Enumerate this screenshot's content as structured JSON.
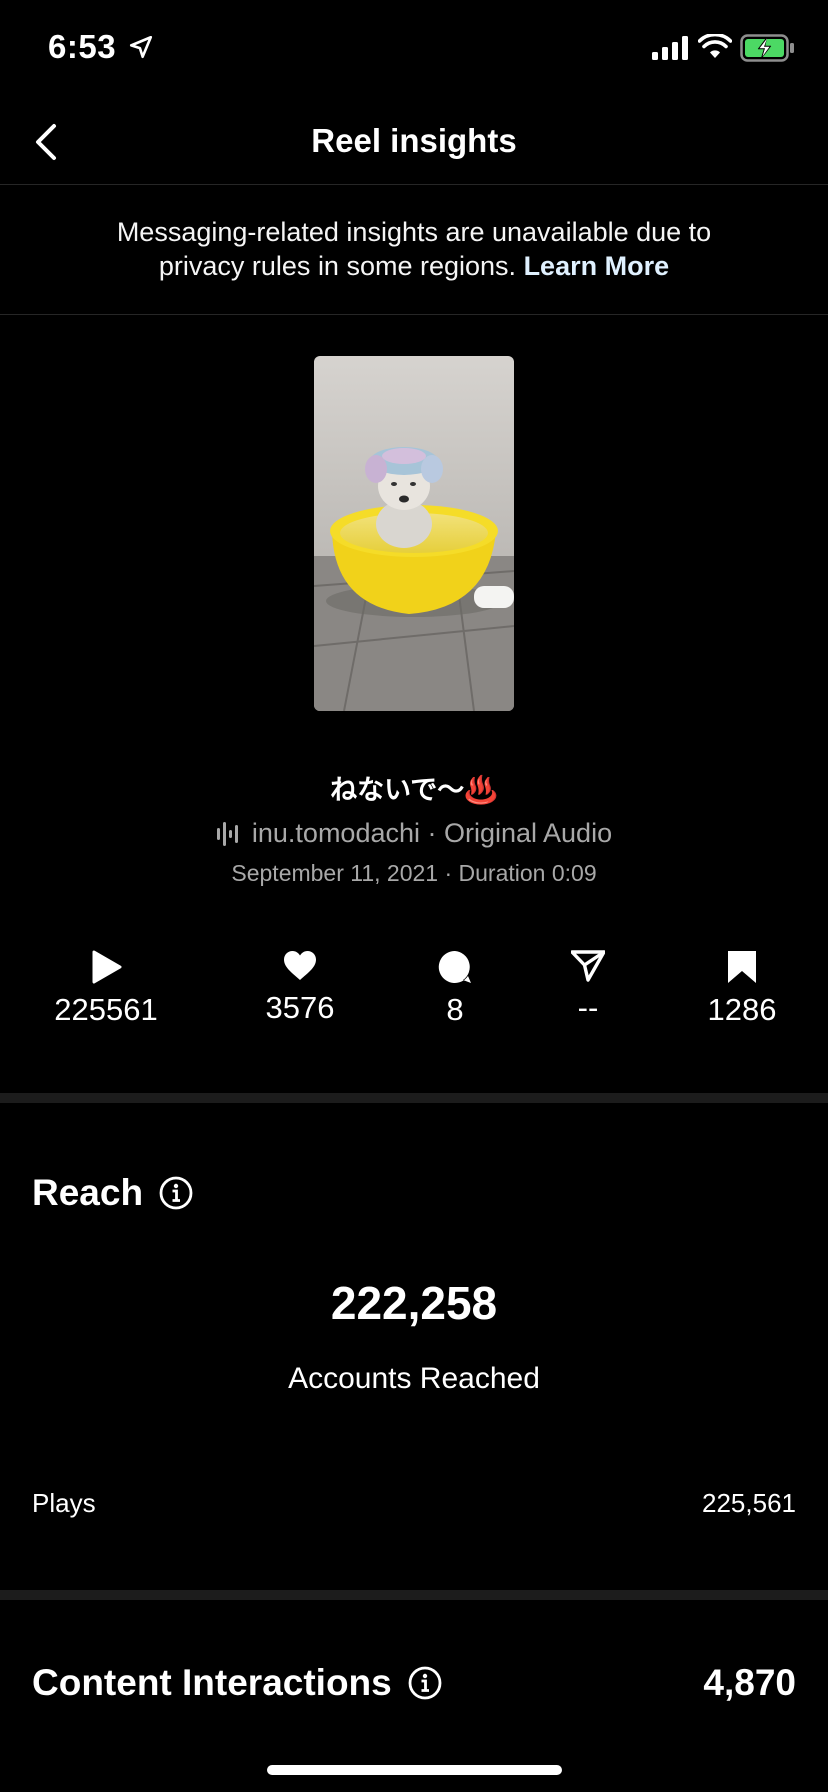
{
  "status_bar": {
    "time": "6:53"
  },
  "nav": {
    "title": "Reel insights"
  },
  "notice": {
    "text": "Messaging-related insights are unavailable due to privacy rules in some regions.",
    "link": "Learn More"
  },
  "reel": {
    "caption": "ねないで〜♨️",
    "audio": "inu.tomodachi · Original Audio",
    "date_duration": "September 11, 2021 · Duration 0:09"
  },
  "stats": {
    "plays": "225561",
    "likes": "3576",
    "comments": "8",
    "shares": "--",
    "saves": "1286"
  },
  "reach": {
    "title": "Reach",
    "accounts_reached": "222,258",
    "accounts_reached_label": "Accounts Reached",
    "plays_label": "Plays",
    "plays_value": "225,561"
  },
  "content_interactions": {
    "title": "Content Interactions",
    "value": "4,870"
  },
  "colors": {
    "background": "#000000",
    "divider": "#1c1c1c",
    "battery": "#4cd964"
  }
}
